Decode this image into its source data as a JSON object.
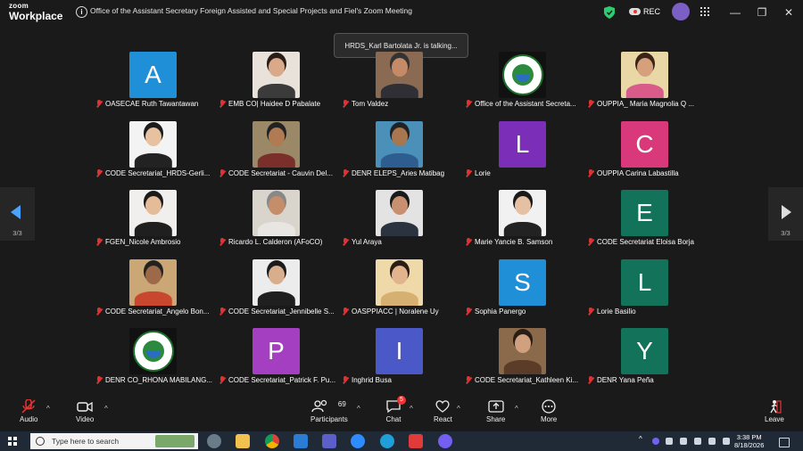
{
  "app": {
    "brand_line1": "zoom",
    "brand_line2": "Workplace",
    "title": "Office of the Assistant Secretary Foreign Assisted and Special Projects and Fiel's Zoom Meeting",
    "rec_label": "REC"
  },
  "window": {
    "minimize": "—",
    "restore": "❐",
    "close": "✕"
  },
  "talking": "HRDS_Karl Bartolata Jr. is talking...",
  "pager": {
    "left": "3/3",
    "right": "3/3"
  },
  "participants": [
    {
      "name": "OASECAE Ruth Tawantawan",
      "avatar": {
        "kind": "letter",
        "letter": "A",
        "color": "#1f8fd8"
      }
    },
    {
      "name": "EMB CO| Haidee D Pabalate",
      "avatar": {
        "kind": "photo",
        "bg": "#e8e2da",
        "skin": "#d9a98a",
        "cloth": "#3b3b3b",
        "hair": "#2a1d16"
      }
    },
    {
      "name": "Tom Valdez",
      "avatar": {
        "kind": "photo",
        "bg": "#8a6a52",
        "skin": "#c58b68",
        "cloth": "#2f2f35",
        "hair": "#333"
      }
    },
    {
      "name": "Office of the Assistant Secreta...",
      "avatar": {
        "kind": "logo"
      }
    },
    {
      "name": "OUPPIA_ Maria Magnolia Q ...",
      "avatar": {
        "kind": "photo",
        "bg": "#e9d8a6",
        "skin": "#d6a07c",
        "cloth": "#d95b8a",
        "hair": "#3a2418"
      }
    },
    {
      "name": "CODE Secretariat_HRDS-Gerli...",
      "avatar": {
        "kind": "photo",
        "bg": "#f3f3f3",
        "skin": "#e8c2a0",
        "cloth": "#222",
        "hair": "#1b1b1b"
      }
    },
    {
      "name": "CODE Secretariat - Cauvin Del...",
      "avatar": {
        "kind": "photo",
        "bg": "#9a8866",
        "skin": "#b07a52",
        "cloth": "#7a2f2a",
        "hair": "#222"
      }
    },
    {
      "name": "DENR ELEPS_Aries Matibag",
      "avatar": {
        "kind": "photo",
        "bg": "#4a90b8",
        "skin": "#a8764f",
        "cloth": "#2e5e90",
        "hair": "#222"
      }
    },
    {
      "name": "Lorie",
      "avatar": {
        "kind": "letter",
        "letter": "L",
        "color": "#7b2fb8"
      }
    },
    {
      "name": "OUPPIA Carina Labastilla",
      "avatar": {
        "kind": "letter",
        "letter": "C",
        "color": "#d9387a"
      }
    },
    {
      "name": "FGEN_Nicole Ambrosio",
      "avatar": {
        "kind": "photo",
        "bg": "#f0efee",
        "skin": "#e5bc9a",
        "cloth": "#1f1f1f",
        "hair": "#1a1a1a"
      }
    },
    {
      "name": "Ricardo L. Calderon (AFoCO)",
      "avatar": {
        "kind": "photo",
        "bg": "#d9d4cc",
        "skin": "#c48e6b",
        "cloth": "#e8e6e2",
        "hair": "#888"
      }
    },
    {
      "name": "Yul Araya",
      "avatar": {
        "kind": "photo",
        "bg": "#e3e3e3",
        "skin": "#c89070",
        "cloth": "#2c3340",
        "hair": "#1a1a1a"
      }
    },
    {
      "name": "Marie Yancie B. Samson",
      "avatar": {
        "kind": "photo",
        "bg": "#f1f1f1",
        "skin": "#e6c0a3",
        "cloth": "#222",
        "hair": "#1a1a1a"
      }
    },
    {
      "name": "CODE Secretariat Eloisa Borja",
      "avatar": {
        "kind": "letter",
        "letter": "E",
        "color": "#13725a"
      }
    },
    {
      "name": "CODE Secretariat_Angelo Bon...",
      "avatar": {
        "kind": "photo",
        "bg": "#caa774",
        "skin": "#9c6a48",
        "cloth": "#c9472e",
        "hair": "#222"
      }
    },
    {
      "name": "CODE Secretariat_Jennibelle S...",
      "avatar": {
        "kind": "photo",
        "bg": "#ececec",
        "skin": "#d9ae8c",
        "cloth": "#1f1f1f",
        "hair": "#1b1b1b"
      }
    },
    {
      "name": "OASPPIACC | Noralene Uy",
      "avatar": {
        "kind": "photo",
        "bg": "#f0d9a8",
        "skin": "#e1b48e",
        "cloth": "#d6b070",
        "hair": "#2a1d16"
      }
    },
    {
      "name": "Sophia Panergo",
      "avatar": {
        "kind": "letter",
        "letter": "S",
        "color": "#1f8fd8"
      }
    },
    {
      "name": "Lorie Basilio",
      "avatar": {
        "kind": "letter",
        "letter": "L",
        "color": "#13725a"
      }
    },
    {
      "name": "DENR CO_RHONA MABILANG...",
      "avatar": {
        "kind": "logo"
      }
    },
    {
      "name": "CODE Secretariat_Patrick F. Pu...",
      "avatar": {
        "kind": "letter",
        "letter": "P",
        "color": "#a43fc2"
      }
    },
    {
      "name": "Inghrid Busa",
      "avatar": {
        "kind": "letter",
        "letter": "I",
        "color": "#4b58c8"
      }
    },
    {
      "name": "CODE Secretariat_Kathleen Ki...",
      "avatar": {
        "kind": "photo",
        "bg": "#8a6a4a",
        "skin": "#d1a07e",
        "cloth": "#5a3c28",
        "hair": "#2a1d16"
      }
    },
    {
      "name": "DENR Yana Peña",
      "avatar": {
        "kind": "letter",
        "letter": "Y",
        "color": "#13725a"
      }
    }
  ],
  "toolbar": {
    "audio": "Audio",
    "video": "Video",
    "participants": "Participants",
    "participants_count": "69",
    "chat": "Chat",
    "chat_badge": "5",
    "react": "React",
    "share": "Share",
    "more": "More",
    "leave": "Leave"
  },
  "taskbar": {
    "search_placeholder": "Type here to search",
    "time": "3:38 PM",
    "date": "8/18/2026"
  },
  "colors": {
    "accent_red": "#e33",
    "bg": "#1a1a1a"
  }
}
